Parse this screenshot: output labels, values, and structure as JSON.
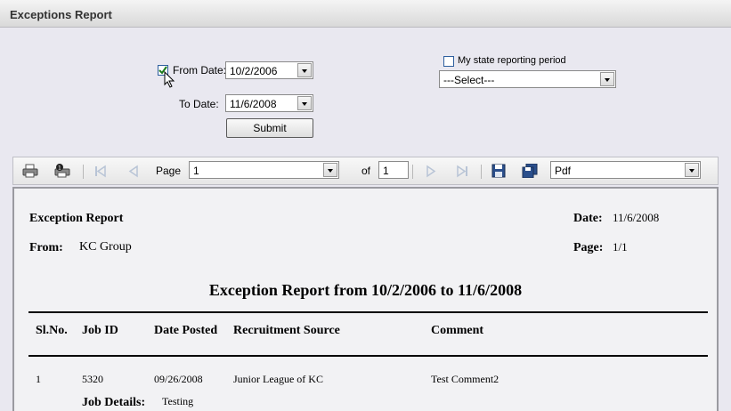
{
  "window": {
    "title": "Exceptions Report"
  },
  "filters": {
    "from_date_label": "From Date:",
    "from_date_value": "10/2/2006",
    "to_date_label": "To Date:",
    "to_date_value": "11/6/2008",
    "submit_label": "Submit",
    "state_period_label": "My state reporting period",
    "state_period_select": "---Select---"
  },
  "toolbar": {
    "page_label": "Page",
    "page_value": "1",
    "of_label": "of",
    "total_pages": "1",
    "export_format": "Pdf"
  },
  "report": {
    "heading": "Exception Report",
    "date_label": "Date:",
    "date_value": "11/6/2008",
    "from_label": "From:",
    "from_value": "KC Group",
    "page_label": "Page:",
    "page_value": "1/1",
    "title": "Exception Report from 10/2/2006 to 11/6/2008",
    "columns": [
      "Sl.No.",
      "Job ID",
      "Date Posted",
      "Recruitment Source",
      "Comment"
    ],
    "rows": [
      {
        "slno": "1",
        "job_id": "5320",
        "date_posted": "09/26/2008",
        "source": "Junior League of KC",
        "comment": "Test Comment2"
      }
    ],
    "job_details_label": "Job Details:",
    "job_details_value": "Testing"
  },
  "colors": {
    "accent": "#2e5f9e",
    "panel": "#e9e8f0",
    "report_bg": "#f2f2f4"
  },
  "icons": [
    "print-icon",
    "print-settings-icon",
    "first-page-icon",
    "prev-page-icon",
    "next-page-icon",
    "last-page-icon",
    "save-icon",
    "export-icon",
    "cursor-icon",
    "checkmark-icon"
  ]
}
